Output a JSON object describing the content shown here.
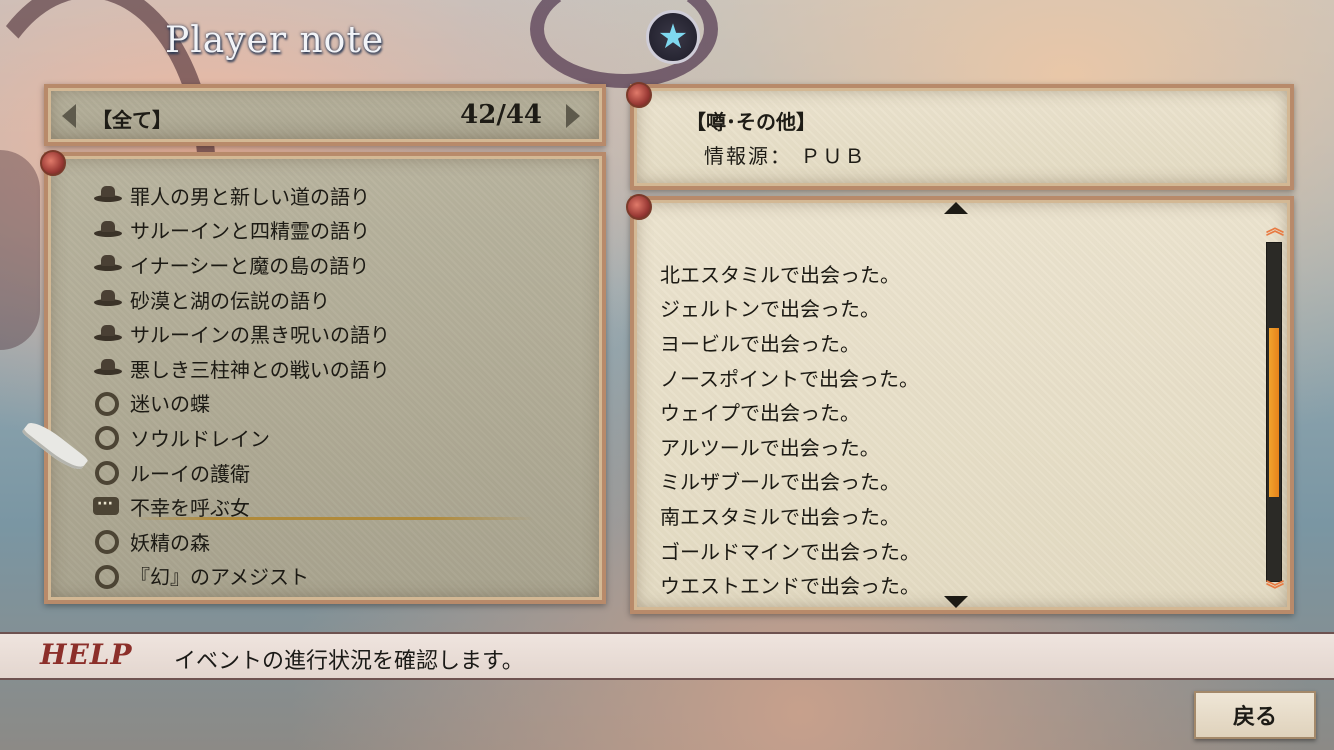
{
  "screen": {
    "title": "Player note"
  },
  "category": {
    "label": "【全て】",
    "count": "42/44"
  },
  "list": {
    "items": [
      {
        "icon": "hat-icon",
        "label": "罪人の男と新しい道の語り"
      },
      {
        "icon": "hat-icon",
        "label": "サルーインと四精霊の語り"
      },
      {
        "icon": "hat-icon",
        "label": "イナーシーと魔の島の語り"
      },
      {
        "icon": "hat-icon",
        "label": "砂漠と湖の伝説の語り"
      },
      {
        "icon": "hat-icon",
        "label": "サルーインの黒き呪いの語り"
      },
      {
        "icon": "hat-icon",
        "label": "悪しき三柱神との戦いの語り"
      },
      {
        "icon": "ring-icon",
        "label": "迷いの蝶"
      },
      {
        "icon": "ring-icon",
        "label": "ソウルドレイン"
      },
      {
        "icon": "ring-icon",
        "label": "ルーイの護衛"
      },
      {
        "icon": "speech-bubble-icon",
        "label": "不幸を呼ぶ女",
        "selected": true
      },
      {
        "icon": "ring-icon",
        "label": "妖精の森"
      },
      {
        "icon": "ring-icon",
        "label": "『幻』のアメジスト"
      }
    ]
  },
  "info": {
    "category": "【噂･その他】",
    "source": "情報源： ＰＵＢ"
  },
  "detail": {
    "lines": [
      "北エスタミルで出会った。",
      "ジェルトンで出会った。",
      "ヨービルで出会った。",
      "ノースポイントで出会った。",
      "ウェイプで出会った。",
      "アルツールで出会った。",
      "ミルザブールで出会った。",
      "南エスタミルで出会った。",
      "ゴールドマインで出会った。",
      "ウエストエンドで出会った。"
    ],
    "scroll_position": 0.5
  },
  "help": {
    "tag": "HELP",
    "text": "イベントの進行状況を確認します。"
  },
  "back_button": {
    "label": "戻る"
  },
  "colors": {
    "accent": "#e6831b",
    "help_tag": "#8c2f2a",
    "star": "#7fd8ef"
  }
}
